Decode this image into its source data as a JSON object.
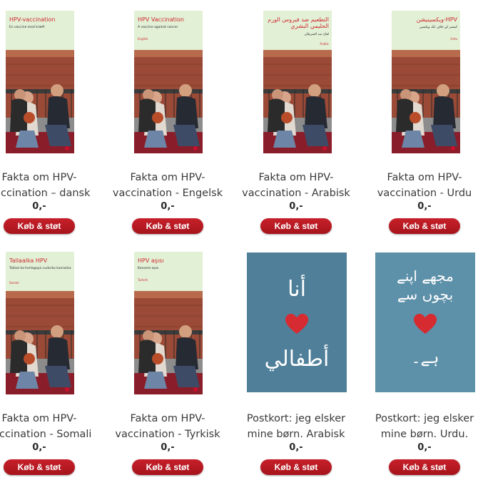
{
  "products": [
    {
      "title_lines": [
        "Fakta om HPV-",
        "vaccination – dansk"
      ],
      "price": "0,-",
      "button": "Køb & støt",
      "cover": {
        "title": "HPV-vaccination",
        "subtitle": "En vaccine mod kræft",
        "language": ""
      }
    },
    {
      "title_lines": [
        "Fakta om HPV-",
        "vaccination - Engelsk"
      ],
      "price": "0,-",
      "button": "Køb & støt",
      "cover": {
        "title": "HPV Vaccination",
        "subtitle": "A vaccine against cancer",
        "language": "English"
      }
    },
    {
      "title_lines": [
        "Fakta om HPV-",
        "vaccination - Arabisk"
      ],
      "price": "0,-",
      "button": "Køb & støt",
      "cover": {
        "title": "التطعيم ضد فيروس الورم الحليمي البشري",
        "subtitle": "لقاح ضد السرطان",
        "language": "Arabic"
      }
    },
    {
      "title_lines": [
        "Fakta om HPV-",
        "vaccination - Urdu"
      ],
      "price": "0,-",
      "button": "Køb & støt",
      "cover": {
        "title": "HPV-ویکسینیشن",
        "subtitle": "کینسر کے خلاف ایک ویکسین",
        "language": "Urdu"
      }
    },
    {
      "title_lines": [
        "Fakta om HPV-",
        "vaccination - Somali"
      ],
      "price": "0,-",
      "button": "Køb & støt",
      "cover": {
        "title": "Tallaalka HPV",
        "subtitle": "Tallaal ka hortagaya cudurka kansarka",
        "language": "Somali"
      }
    },
    {
      "title_lines": [
        "Fakta om HPV-",
        "vaccination - Tyrkisk"
      ],
      "price": "0,-",
      "button": "Køb & støt",
      "cover": {
        "title": "HPV aşısı",
        "subtitle": "Kansere aşısı",
        "language": "Turkish"
      }
    },
    {
      "title_lines": [
        "Postkort: jeg elsker",
        "mine børn. Arabisk"
      ],
      "price": "0,-",
      "button": "Køb & støt",
      "postcard": {
        "top": "أنا",
        "bottom": "أطفالي"
      }
    },
    {
      "title_lines": [
        "Postkort: jeg elsker",
        "mine børn. Urdu."
      ],
      "price": "0,-",
      "button": "Køb & støt",
      "postcard": {
        "top": "مجھے اپنے بچوں سے",
        "bottom": "ہے۔"
      }
    }
  ],
  "colors": {
    "button": "#b71c23",
    "heart": "#d62b30",
    "cover_bg": "#e2f0d6",
    "postcard_arabic": "#4f7f99",
    "postcard_urdu": "#5d90a9"
  }
}
